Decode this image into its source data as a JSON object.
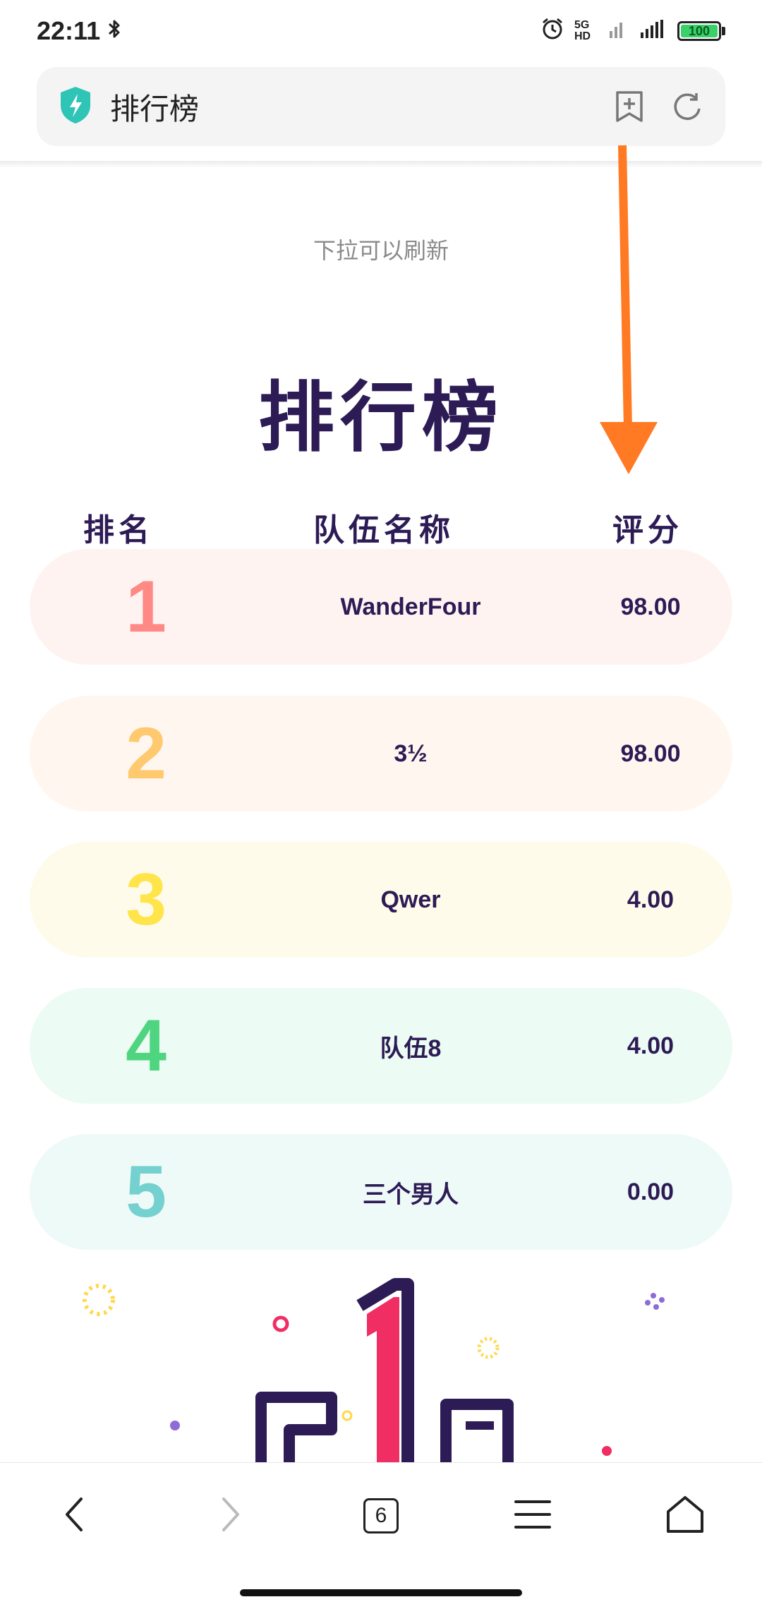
{
  "status_bar": {
    "time": "22:11",
    "network": "5G HD",
    "battery": "100"
  },
  "address_bar": {
    "title": "排行榜"
  },
  "page": {
    "pull_hint": "下拉可以刷新",
    "title": "排行榜",
    "columns": {
      "rank": "排名",
      "team": "队伍名称",
      "score": "评分"
    },
    "rows": [
      {
        "rank": "1",
        "team": "WanderFour",
        "score": "98.00"
      },
      {
        "rank": "2",
        "team": "3½",
        "score": "98.00"
      },
      {
        "rank": "3",
        "team": "Qwer",
        "score": "4.00"
      },
      {
        "rank": "4",
        "team": "队伍8",
        "score": "4.00"
      },
      {
        "rank": "5",
        "team": "三个男人",
        "score": "0.00"
      }
    ]
  },
  "bottom_nav": {
    "tab_count": "6"
  },
  "colors": {
    "title": "#2d1b55",
    "rank1": "#ff8a85",
    "rank2": "#ffc970",
    "rank3": "#ffe44a",
    "rank4": "#4fd47f",
    "rank5": "#74d1cf",
    "row1_bg": "#fff3f2",
    "row2_bg": "#fff7ef",
    "row3_bg": "#fffbea",
    "row4_bg": "#ecfbf3",
    "row5_bg": "#eefaf8",
    "arrow": "#ff7a22"
  }
}
